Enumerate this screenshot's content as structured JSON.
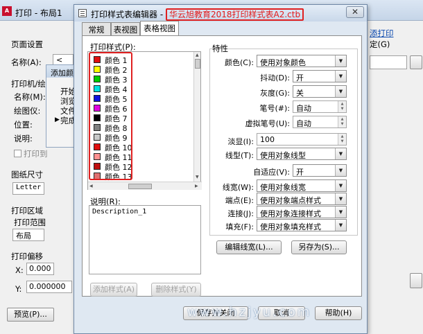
{
  "background_window": {
    "title": "打印 - 布局1",
    "labels": {
      "page_setup": "页面设置",
      "name": "名称(A):",
      "name_value": "<无",
      "printer": "打印机/绘",
      "printer_name": "名称(M):",
      "plotter": "绘图仪:",
      "location": "位置:",
      "description": "说明:",
      "print_to_file": "打印到",
      "paper_size": "图纸尺寸",
      "paper_value": "Letter",
      "plot_area": "打印区域",
      "plot_range": "打印范围",
      "plot_range_value": "布局",
      "plot_offset": "打印偏移",
      "x": "X:",
      "x_value": "0.000",
      "y": "Y:",
      "y_value": "0.000000",
      "preview": "预览(P)...",
      "add_link": "添打印",
      "set_label": "定(G)",
      "sub_dialog_title": "添加颜色",
      "sub_lines": [
        "开始",
        "浏览",
        "文件",
        "完成"
      ]
    }
  },
  "dialog": {
    "title_prefix": "打印样式表编辑器 - ",
    "title_file": "华云旭教育2018打印样式表A2.ctb",
    "close_glyph": "✕",
    "tabs": [
      "常规",
      "表视图",
      "表格视图"
    ],
    "active_tab": 2,
    "plot_styles_label": "打印样式(P):",
    "plot_styles": [
      {
        "label": "颜色 1",
        "color": "#e01010"
      },
      {
        "label": "颜色 2",
        "color": "#ffff00"
      },
      {
        "label": "颜色 3",
        "color": "#00cc00"
      },
      {
        "label": "颜色 4",
        "color": "#00e0e0"
      },
      {
        "label": "颜色 5",
        "color": "#1010e0"
      },
      {
        "label": "颜色 6",
        "color": "#e000e0"
      },
      {
        "label": "颜色 7",
        "color": "#000000"
      },
      {
        "label": "颜色 8",
        "color": "#808080"
      },
      {
        "label": "颜色 9",
        "color": "#c8c8c8"
      },
      {
        "label": "颜色 10",
        "color": "#e01010"
      },
      {
        "label": "颜色 11",
        "color": "#ff9090"
      },
      {
        "label": "颜色 12",
        "color": "#c01010"
      },
      {
        "label": "颜色 13",
        "color": "#e07070"
      }
    ],
    "description_label": "说明(R):",
    "description_value": "Description_1",
    "add_style_btn": "添加样式(A)",
    "delete_style_btn": "删除样式(Y)",
    "properties": {
      "group_label": "特性",
      "color_label": "颜色(C):",
      "color_value": "使用对象颜色",
      "dither_label": "抖动(D):",
      "dither_value": "开",
      "grayscale_label": "灰度(G):",
      "grayscale_value": "关",
      "pen_label": "笔号(#):",
      "pen_value": "自动",
      "virtual_pen_label": "虚拟笔号(U):",
      "virtual_pen_value": "自动",
      "screening_label": "淡显(I):",
      "screening_value": "100",
      "linetype_label": "线型(T):",
      "linetype_value": "使用对象线型",
      "adaptive_label": "自适应(V):",
      "adaptive_value": "开",
      "lineweight_label": "线宽(W):",
      "lineweight_value": "使用对象线宽",
      "endstyle_label": "端点(E):",
      "endstyle_value": "使用对象端点样式",
      "joinstyle_label": "连接(J):",
      "joinstyle_value": "使用对象连接样式",
      "fillstyle_label": "填充(F):",
      "fillstyle_value": "使用对象填充样式"
    },
    "edit_lineweights_btn": "编辑线宽(L)...",
    "save_as_btn": "另存为(S)...",
    "bottom_buttons": [
      "保存并关闭",
      "取消",
      "帮助(H)"
    ]
  },
  "watermark": "www.hzjyu.com"
}
